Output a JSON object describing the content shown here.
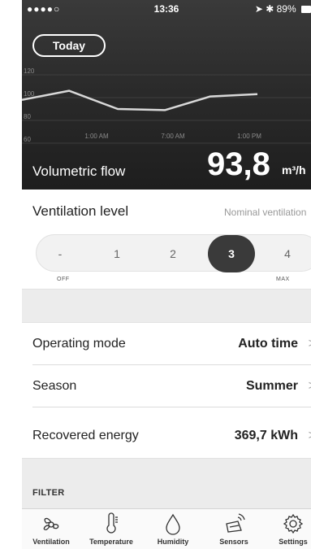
{
  "status_bar": {
    "signal": "●●●●○",
    "time": "13:36",
    "battery": "89%"
  },
  "header": {
    "today_button": "Today",
    "metric_label": "Volumetric flow",
    "metric_value": "93,8",
    "metric_unit": "m³/h"
  },
  "chart_data": {
    "type": "line",
    "y_ticks": [
      "120",
      "100",
      "80",
      "60"
    ],
    "x_ticks": [
      "1:00 AM",
      "7:00 AM",
      "1:00 PM"
    ],
    "ylim": [
      50,
      130
    ],
    "points": [
      98,
      106,
      90,
      89,
      101,
      103
    ]
  },
  "ventilation": {
    "title": "Ventilation level",
    "mode": "Nominal ventilation",
    "levels": [
      "-",
      "1",
      "2",
      "3",
      "4"
    ],
    "selected": "3",
    "min_label": "OFF",
    "max_label": "MAX"
  },
  "rows": [
    {
      "label": "Operating mode",
      "value": "Auto time"
    },
    {
      "label": "Season",
      "value": "Summer"
    },
    {
      "label": "Recovered energy",
      "value": "369,7 kWh"
    }
  ],
  "filter_header": "FILTER",
  "tabs": [
    {
      "label": "Ventilation",
      "icon": "fan-icon"
    },
    {
      "label": "Temperature",
      "icon": "thermometer-icon"
    },
    {
      "label": "Humidity",
      "icon": "droplet-icon"
    },
    {
      "label": "Sensors",
      "icon": "sensor-icon"
    },
    {
      "label": "Settings",
      "icon": "gear-icon"
    }
  ],
  "colors": {
    "header_bg": "#2b2b2b",
    "active_level": "#3a3a3a",
    "section_gap": "#ececec"
  }
}
